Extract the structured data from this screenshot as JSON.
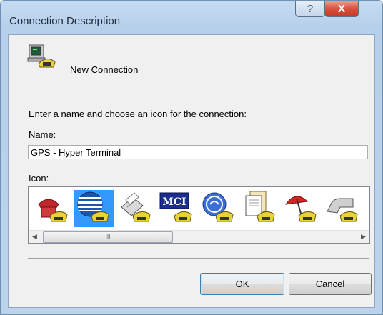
{
  "window": {
    "title": "Connection Description",
    "help_glyph": "?",
    "close_glyph": "X"
  },
  "header": {
    "icon": "hyperterminal-phone-computer-icon",
    "label": "New Connection"
  },
  "form": {
    "prompt": "Enter a name and choose an icon for the connection:",
    "name_label": "Name:",
    "name_value": "GPS - Hyper Terminal",
    "icon_label": "Icon:"
  },
  "icons": [
    {
      "name": "red-phone-icon",
      "selected": false
    },
    {
      "name": "att-globe-icon",
      "selected": true
    },
    {
      "name": "fax-machine-icon",
      "selected": false
    },
    {
      "name": "mci-icon",
      "selected": false,
      "text": "MCI"
    },
    {
      "name": "ge-logo-icon",
      "selected": false
    },
    {
      "name": "documents-icon",
      "selected": false
    },
    {
      "name": "umbrella-icon",
      "selected": false
    },
    {
      "name": "pipe-icon",
      "selected": false
    }
  ],
  "scrollbar": {
    "left_arrow": "◀",
    "right_arrow": "▶",
    "thumb_grip": "III"
  },
  "buttons": {
    "ok": "OK",
    "cancel": "Cancel"
  },
  "colors": {
    "selection": "#3399ff",
    "close_button": "#d7533f"
  }
}
